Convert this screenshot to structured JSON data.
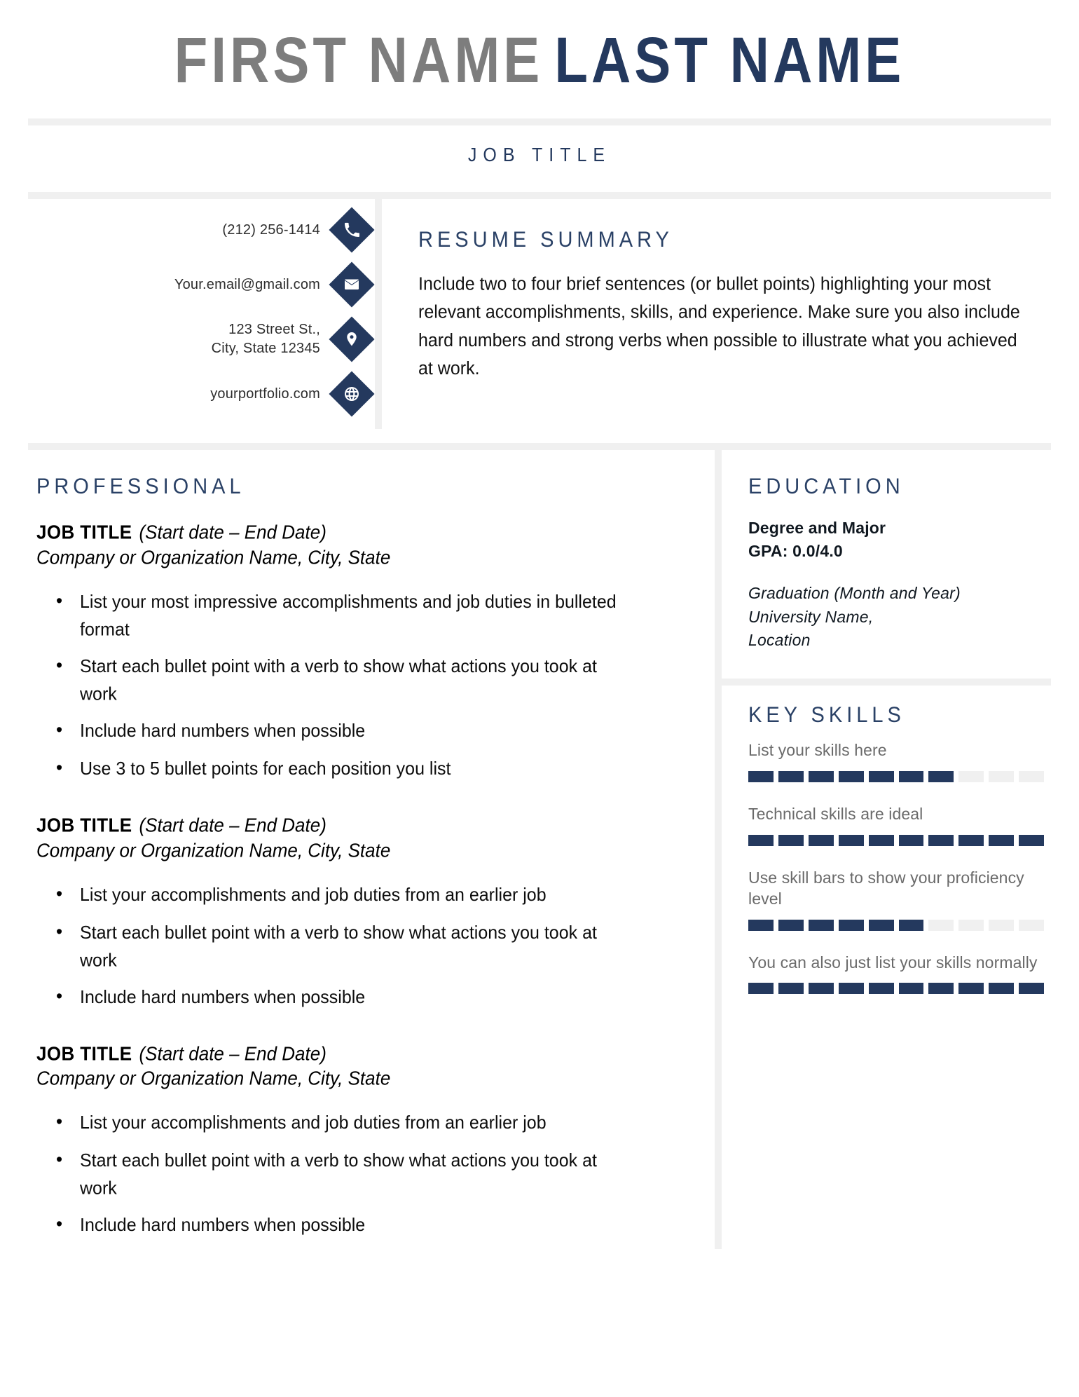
{
  "header": {
    "first_name": "FIRST NAME",
    "last_name": "LAST NAME",
    "job_title": "JOB TITLE",
    "name_color_first": "#7d7d7d",
    "name_color_last": "#24395e"
  },
  "contact": {
    "items": [
      {
        "icon": "phone-icon",
        "text": "(212) 256-1414"
      },
      {
        "icon": "envelope-icon",
        "text": "Your.email@gmail.com"
      },
      {
        "icon": "location-pin-icon",
        "text": "123 Street St.,\nCity, State 12345"
      },
      {
        "icon": "globe-icon",
        "text": "yourportfolio.com"
      }
    ]
  },
  "summary": {
    "heading": "RESUME SUMMARY",
    "body": "Include two to four brief sentences (or bullet points) highlighting your most relevant accomplishments, skills, and experience. Make sure you also include hard numbers and strong verbs when possible to illustrate what you achieved at work."
  },
  "professional": {
    "heading": "PROFESSIONAL",
    "jobs": [
      {
        "role": "JOB TITLE",
        "dates": "(Start date – End Date)",
        "company": "Company or Organization Name, City, State",
        "duties": [
          "List your most impressive accomplishments and job duties in bulleted format",
          "Start each bullet point with a verb to show what actions you took at work",
          "Include hard numbers when possible",
          "Use 3 to 5 bullet points for each position you list"
        ]
      },
      {
        "role": "JOB TITLE",
        "dates": "(Start date – End Date)",
        "company": "Company or Organization Name, City, State",
        "duties": [
          "List your accomplishments and job duties from an earlier job",
          "Start each bullet point with a verb to show what actions you took at work",
          "Include hard numbers when possible"
        ]
      },
      {
        "role": "JOB TITLE",
        "dates": "(Start date – End Date)",
        "company": "Company or Organization Name, City, State",
        "duties": [
          "List your accomplishments and job duties from an earlier job",
          "Start each bullet point with a verb to show what actions you took at work",
          "Include hard numbers when possible"
        ]
      }
    ]
  },
  "education": {
    "heading": "EDUCATION",
    "degree": "Degree and Major",
    "gpa": "GPA: 0.0/4.0",
    "graduation": "Graduation (Month and Year)",
    "university": "University Name,",
    "location": "Location"
  },
  "key_skills": {
    "heading": "KEY SKILLS",
    "segments_total": 10,
    "items": [
      {
        "label": "List your skills here",
        "filled": 7
      },
      {
        "label": "Technical skills are ideal",
        "filled": 10
      },
      {
        "label": "Use skill bars to show your proficiency level",
        "filled": 6
      },
      {
        "label": "You can also just list your skills normally",
        "filled": 10
      }
    ]
  },
  "theme": {
    "navy": "#24395e",
    "gray_rule": "#f0f0f0",
    "name_gray": "#7d7d7d",
    "skill_label_gray": "#6a6a6a"
  }
}
